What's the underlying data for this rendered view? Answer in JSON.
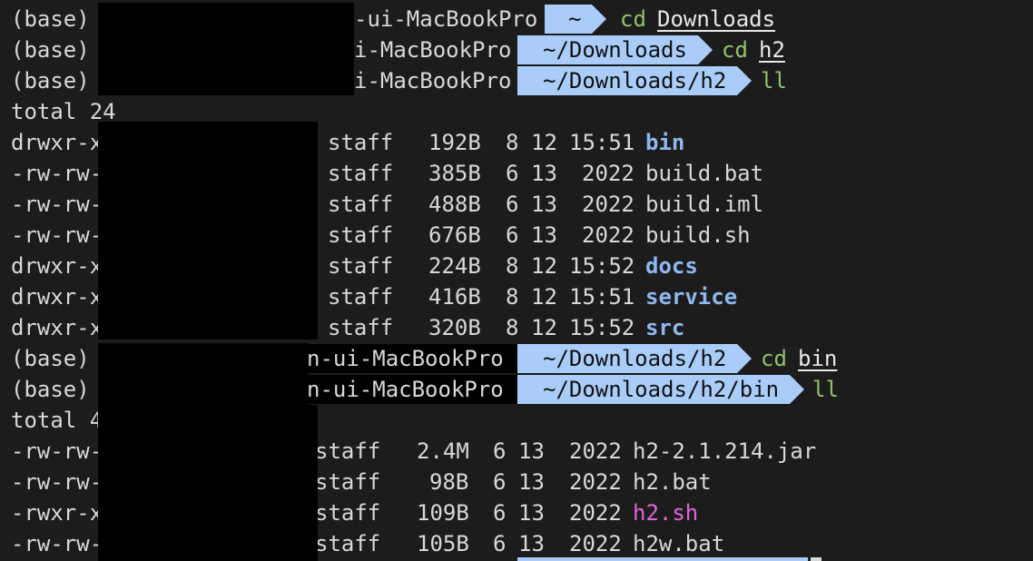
{
  "prompts": [
    {
      "env": "(base)",
      "host": "-ui-MacBookPro",
      "path": "~",
      "cmd": "cd",
      "arg": "Downloads"
    },
    {
      "env": "(base)",
      "host": "i-MacBookPro",
      "path": "~/Downloads",
      "cmd": "cd",
      "arg": "h2"
    },
    {
      "env": "(base)",
      "host": "i-MacBookPro",
      "path": "~/Downloads/h2",
      "cmd": "ll",
      "arg": ""
    },
    {
      "env": "(base)",
      "host": "n-ui-MacBookPro",
      "path": "~/Downloads/h2",
      "cmd": "cd",
      "arg": "bin"
    },
    {
      "env": "(base)",
      "host": "n-ui-MacBookPro",
      "path": "~/Downloads/h2/bin",
      "cmd": "ll",
      "arg": ""
    }
  ],
  "listing1": {
    "total": "total 24",
    "rows": [
      {
        "perm": "drwxr-x",
        "group": "staff",
        "size": "192B",
        "month": "8",
        "day": "12",
        "time": "15:51",
        "name": "bin",
        "kind": "dir"
      },
      {
        "perm": "-rw-rw-",
        "group": "staff",
        "size": "385B",
        "month": "6",
        "day": "13",
        "time": "2022",
        "name": "build.bat",
        "kind": "file"
      },
      {
        "perm": "-rw-rw-",
        "group": "staff",
        "size": "488B",
        "month": "6",
        "day": "13",
        "time": "2022",
        "name": "build.iml",
        "kind": "file"
      },
      {
        "perm": "-rw-rw-",
        "group": "staff",
        "size": "676B",
        "month": "6",
        "day": "13",
        "time": "2022",
        "name": "build.sh",
        "kind": "file"
      },
      {
        "perm": "drwxr-x",
        "group": "staff",
        "size": "224B",
        "month": "8",
        "day": "12",
        "time": "15:52",
        "name": "docs",
        "kind": "dir"
      },
      {
        "perm": "drwxr-x",
        "group": "staff",
        "size": "416B",
        "month": "8",
        "day": "12",
        "time": "15:51",
        "name": "service",
        "kind": "dir"
      },
      {
        "perm": "drwxr-x",
        "group": "staff",
        "size": "320B",
        "month": "8",
        "day": "12",
        "time": "15:52",
        "name": "src",
        "kind": "dir"
      }
    ]
  },
  "listing2": {
    "total": "total 4",
    "rows": [
      {
        "perm": "-rw-rw-",
        "group": "staff",
        "size": "2.4M",
        "month": "6",
        "day": "13",
        "time": "2022",
        "name": "h2-2.1.214.jar",
        "kind": "file"
      },
      {
        "perm": "-rw-rw-",
        "group": "staff",
        "size": "98B",
        "month": "6",
        "day": "13",
        "time": "2022",
        "name": "h2.bat",
        "kind": "file"
      },
      {
        "perm": "-rwxr-x",
        "group": "staff",
        "size": "109B",
        "month": "6",
        "day": "13",
        "time": "2022",
        "name": "h2.sh",
        "kind": "exe"
      },
      {
        "perm": "-rw-rw-",
        "group": "staff",
        "size": "105B",
        "month": "6",
        "day": "13",
        "time": "2022",
        "name": "h2w.bat",
        "kind": "file"
      }
    ]
  },
  "colors": {
    "background": "#1c1c1c",
    "path_segment": "#a9cdf8",
    "command": "#8fc26a",
    "directory": "#8fb8ef",
    "executable": "#e264d8"
  }
}
